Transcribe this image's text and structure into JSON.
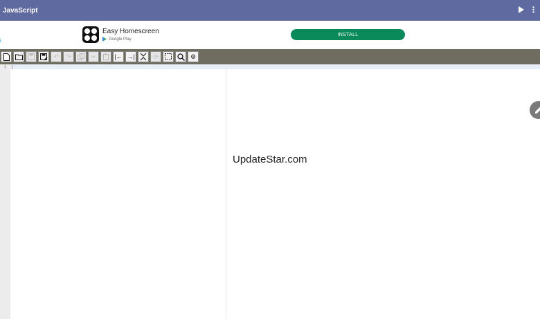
{
  "appbar": {
    "title": "JavaScript",
    "bg": "#5f6aa0"
  },
  "ad": {
    "marker": "i",
    "app_name": "Easy Homescreen",
    "store": "Google Play",
    "install_label": "INSTALL",
    "install_color": "#0a8a5a"
  },
  "toolbar": {
    "buttons": [
      {
        "name": "new-file-icon",
        "enabled": true
      },
      {
        "name": "open-folder-icon",
        "enabled": true
      },
      {
        "name": "save-icon",
        "enabled": false
      },
      {
        "name": "save-as-icon",
        "enabled": true
      },
      {
        "name": "undo-icon",
        "enabled": false
      },
      {
        "name": "redo-icon",
        "enabled": false
      },
      {
        "name": "copy-icon",
        "enabled": false
      },
      {
        "name": "cut-icon",
        "enabled": false
      },
      {
        "name": "paste-icon",
        "enabled": false
      },
      {
        "name": "outdent-icon",
        "enabled": true
      },
      {
        "name": "indent-icon",
        "enabled": true
      },
      {
        "name": "collapse-icon",
        "enabled": true
      },
      {
        "name": "format-icon",
        "enabled": false
      },
      {
        "name": "select-all-icon",
        "enabled": true
      },
      {
        "name": "search-icon",
        "enabled": true
      },
      {
        "name": "settings-gear-icon",
        "enabled": true
      }
    ]
  },
  "editor": {
    "line_number": "1"
  },
  "preview": {
    "text": "UpdateStar.com"
  }
}
